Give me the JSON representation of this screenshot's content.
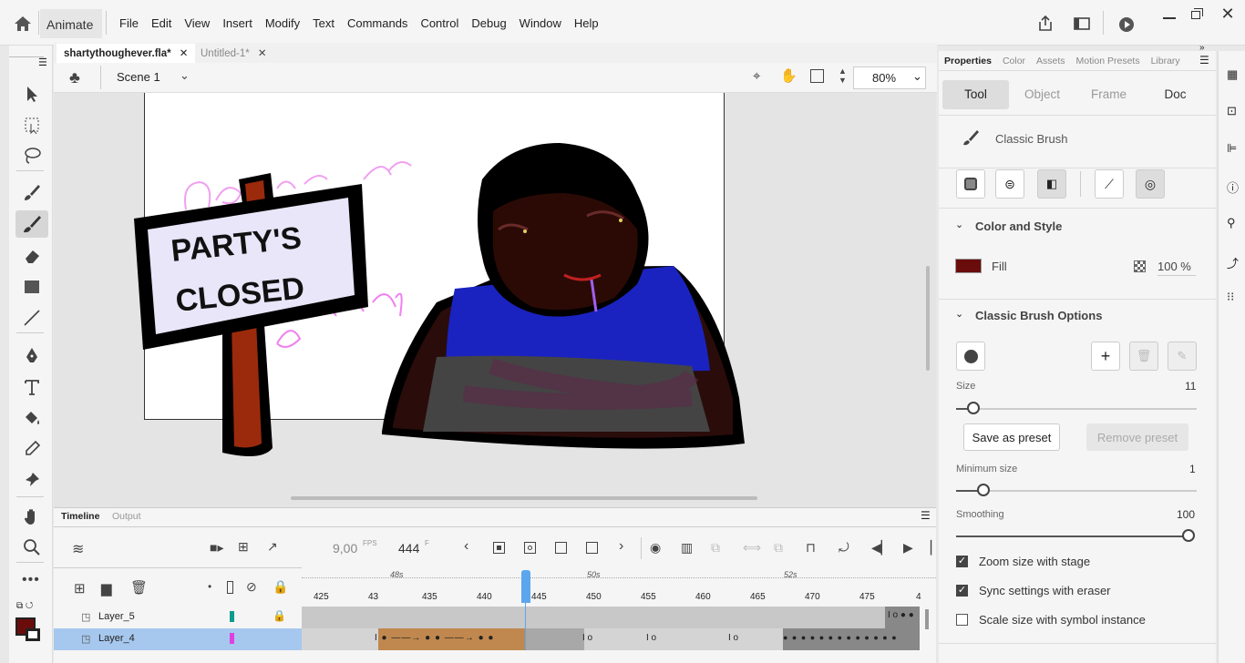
{
  "app": {
    "name": "Animate"
  },
  "menu": [
    "File",
    "Edit",
    "View",
    "Insert",
    "Modify",
    "Text",
    "Commands",
    "Control",
    "Debug",
    "Window",
    "Help"
  ],
  "tabs": [
    {
      "label": "shartythoughever.fla*"
    },
    {
      "label": "Untitled-1*"
    }
  ],
  "scene": {
    "label": "Scene 1",
    "zoom": "80%"
  },
  "artwork": {
    "sign_line1": "PARTY'S",
    "sign_line2": "CLOSED"
  },
  "timeline": {
    "tab_timeline": "Timeline",
    "tab_output": "Output",
    "fps": "9,00",
    "fps_unit": "FPS",
    "frame": "444",
    "frame_unit": "F",
    "ruler_secs": [
      "48s",
      "50s",
      "52s"
    ],
    "ruler": [
      "425",
      "43",
      "435",
      "440",
      "445",
      "450",
      "455",
      "460",
      "465",
      "470",
      "475",
      "4"
    ],
    "layers": [
      {
        "name": "Layer_5",
        "color": "#0a9c8c"
      },
      {
        "name": "Layer_4",
        "color": "#e040e0"
      }
    ]
  },
  "panel": {
    "tabs": [
      "Properties",
      "Color",
      "Assets",
      "Motion Presets",
      "Library"
    ],
    "segments": [
      "Tool",
      "Object",
      "Frame",
      "Doc"
    ],
    "tool_name": "Classic Brush",
    "color_section": "Color and Style",
    "fill_label": "Fill",
    "fill_color": "#6b0c0c",
    "fill_alpha": "100 %",
    "brush_section": "Classic Brush Options",
    "size_label": "Size",
    "size_value": "11",
    "save_preset": "Save as preset",
    "remove_preset": "Remove preset",
    "min_size_label": "Minimum size",
    "min_size_value": "1",
    "smoothing_label": "Smoothing",
    "smoothing_value": "100",
    "checks": [
      {
        "label": "Zoom size with stage",
        "checked": true
      },
      {
        "label": "Sync settings with eraser",
        "checked": true
      },
      {
        "label": "Scale size with symbol instance",
        "checked": false
      }
    ]
  }
}
